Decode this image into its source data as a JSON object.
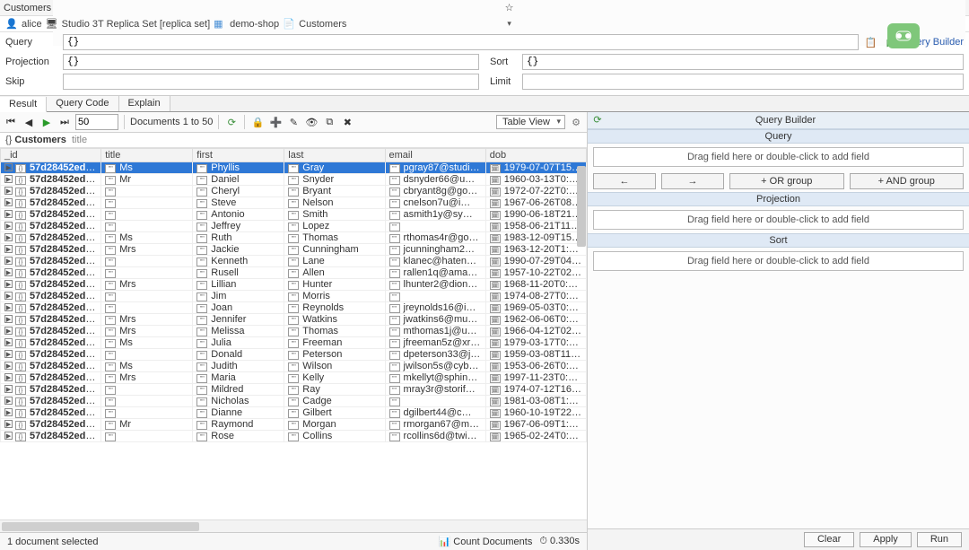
{
  "tabTitle": "Customers",
  "breadcrumb": {
    "user": "alice",
    "server": "Studio 3T Replica Set [replica set]",
    "db": "demo-shop",
    "coll": "Customers"
  },
  "query": {
    "label": "Query",
    "value": "{}",
    "queryBuilderLink": "Query Builder"
  },
  "projection": {
    "label": "Projection",
    "value": "{}"
  },
  "sort": {
    "label": "Sort",
    "value": "{}"
  },
  "skip": {
    "label": "Skip",
    "value": ""
  },
  "limit": {
    "label": "Limit",
    "value": ""
  },
  "resultTabs": [
    "Result",
    "Query Code",
    "Explain"
  ],
  "pageSize": "50",
  "docLabel": "Documents 1 to 50",
  "viewMode": "Table View",
  "pathColl": "Customers",
  "pathField": "title",
  "columns": [
    "_id",
    "title",
    "first",
    "last",
    "email",
    "dob"
  ],
  "rows": [
    {
      "id": "57d28452ed5d…",
      "title": "Ms",
      "first": "Phyllis",
      "last": "Gray",
      "email": "pgray87@studi…",
      "dob": "1979-07-07T15:…",
      "sel": true
    },
    {
      "id": "57d28452ed5d…",
      "title": "Mr",
      "first": "Daniel",
      "last": "Snyder",
      "email": "dsnyder66@u…",
      "dob": "1960-03-13T0:…"
    },
    {
      "id": "57d28452ed5d…",
      "title": "",
      "first": "Cheryl",
      "last": "Bryant",
      "email": "cbryant8g@go…",
      "dob": "1972-07-22T0:…"
    },
    {
      "id": "57d28452ed5d…",
      "title": "",
      "first": "Steve",
      "last": "Nelson",
      "email": "cnelson7u@i…",
      "dob": "1967-06-26T08:…"
    },
    {
      "id": "57d28452ed5d…",
      "title": "",
      "first": "Antonio",
      "last": "Smith",
      "email": "asmith1y@sy…",
      "dob": "1990-06-18T21:…"
    },
    {
      "id": "57d28452ed5d…",
      "title": "",
      "first": "Jeffrey",
      "last": "Lopez",
      "email": "",
      "dob": "1958-06-21T11:…"
    },
    {
      "id": "57d28452ed5d…",
      "title": "Ms",
      "first": "Ruth",
      "last": "Thomas",
      "email": "rthomas4r@go…",
      "dob": "1983-12-09T15:…"
    },
    {
      "id": "57d28452ed5d…",
      "title": "Mrs",
      "first": "Jackie",
      "last": "Cunningham",
      "email": "jcunningham2…",
      "dob": "1963-12-20T1:…"
    },
    {
      "id": "57d28452ed5d…",
      "title": "",
      "first": "Kenneth",
      "last": "Lane",
      "email": "klanec@haten…",
      "dob": "1990-07-29T04:…"
    },
    {
      "id": "57d28452ed5d…",
      "title": "",
      "first": "Rusell",
      "last": "Allen",
      "email": "rallen1q@ama…",
      "dob": "1957-10-22T02:…"
    },
    {
      "id": "57d28452ed5d…",
      "title": "Mrs",
      "first": "Lillian",
      "last": "Hunter",
      "email": "lhunter2@dion…",
      "dob": "1968-11-20T0:…"
    },
    {
      "id": "57d28452ed5d…",
      "title": "",
      "first": "Jim",
      "last": "Morris",
      "email": "",
      "dob": "1974-08-27T0:…"
    },
    {
      "id": "57d28452ed5d…",
      "title": "",
      "first": "Joan",
      "last": "Reynolds",
      "email": "jreynolds16@i…",
      "dob": "1969-05-03T0:…"
    },
    {
      "id": "57d28452ed5d…",
      "title": "Mrs",
      "first": "Jennifer",
      "last": "Watkins",
      "email": "jwatkins6@mu…",
      "dob": "1962-06-06T0:…"
    },
    {
      "id": "57d28452ed5d…",
      "title": "Mrs",
      "first": "Melissa",
      "last": "Thomas",
      "email": "mthomas1j@u…",
      "dob": "1966-04-12T02:…"
    },
    {
      "id": "57d28452ed5d…",
      "title": "Ms",
      "first": "Julia",
      "last": "Freeman",
      "email": "jfreeman5z@xr…",
      "dob": "1979-03-17T0:…"
    },
    {
      "id": "57d28452ed5d…",
      "title": "",
      "first": "Donald",
      "last": "Peterson",
      "email": "dpeterson33@j…",
      "dob": "1959-03-08T11:…"
    },
    {
      "id": "57d28452ed5d…",
      "title": "Ms",
      "first": "Judith",
      "last": "Wilson",
      "email": "jwilson5s@cyb…",
      "dob": "1953-06-26T0:…"
    },
    {
      "id": "57d28452ed5d…",
      "title": "Mrs",
      "first": "Maria",
      "last": "Kelly",
      "email": "mkellyt@sphin…",
      "dob": "1997-11-23T0:…"
    },
    {
      "id": "57d28452ed5d…",
      "title": "",
      "first": "Mildred",
      "last": "Ray",
      "email": "mray3r@storif…",
      "dob": "1974-07-12T16:…"
    },
    {
      "id": "57d28452ed5d…",
      "title": "",
      "first": "Nicholas",
      "last": "Cadge",
      "email": "",
      "dob": "1981-03-08T1:…"
    },
    {
      "id": "57d28452ed5d…",
      "title": "",
      "first": "Dianne",
      "last": "Gilbert",
      "email": "dgilbert44@c…",
      "dob": "1960-10-19T22:…"
    },
    {
      "id": "57d28452ed5d…",
      "title": "Mr",
      "first": "Raymond",
      "last": "Morgan",
      "email": "rmorgan67@m…",
      "dob": "1967-06-09T1:…"
    },
    {
      "id": "57d28452ed5d…",
      "title": "",
      "first": "Rose",
      "last": "Collins",
      "email": "rcollins6d@twi…",
      "dob": "1965-02-24T0:…"
    }
  ],
  "status": {
    "selected": "1 document selected",
    "count": "Count Documents",
    "time": "0.330s"
  },
  "qb": {
    "title": "Query Builder",
    "query": "Query",
    "drop": "Drag field here or double-click to add field",
    "left": "←",
    "right": "→",
    "or": "+ OR group",
    "and": "+ AND group",
    "proj": "Projection",
    "sort": "Sort"
  },
  "buttons": {
    "clear": "Clear",
    "apply": "Apply",
    "run": "Run"
  }
}
